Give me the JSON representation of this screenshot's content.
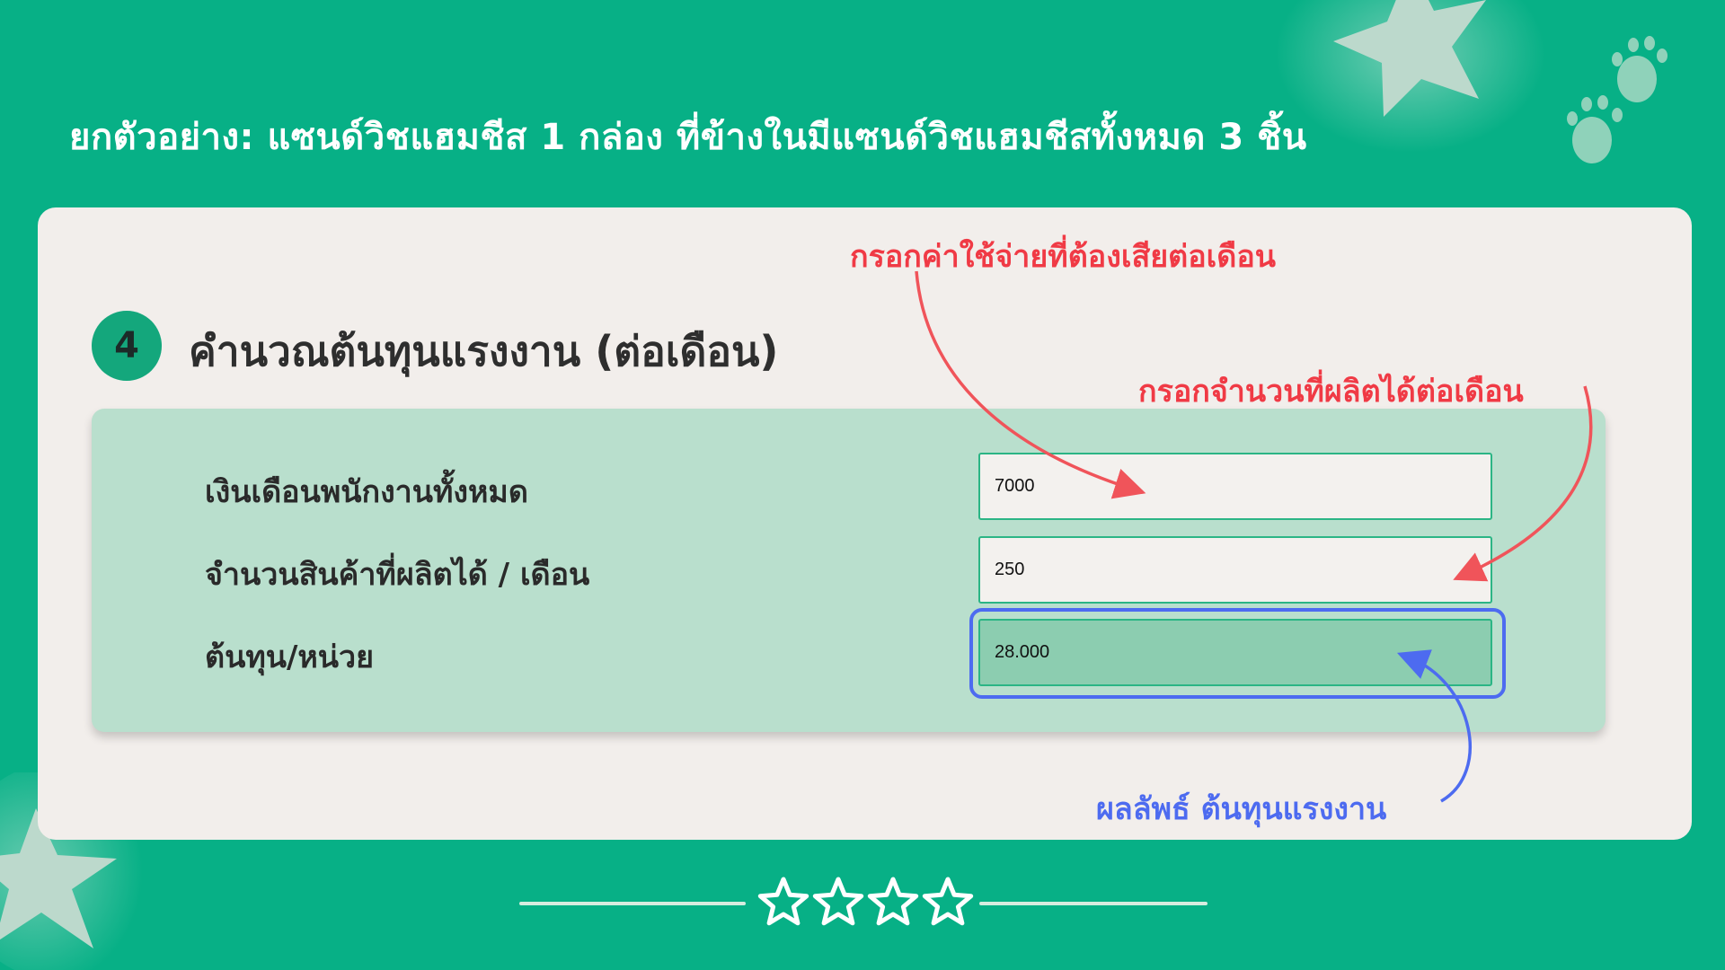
{
  "header": {
    "title": "ยกตัวอย่าง: แซนด์วิชแฮมชีส 1 กล่อง ที่ข้างในมีแซนด์วิชแฮมชีสทั้งหมด 3 ชิ้น"
  },
  "section": {
    "step_number": "4",
    "title": "คำนวณต้นทุนแรงงาน (ต่อเดือน)"
  },
  "form": {
    "fields": [
      {
        "label": "เงินเดือนพนักงานทั้งหมด",
        "value": "7000"
      },
      {
        "label": "จำนวนสินค้าที่ผลิตได้ / เดือน",
        "value": "250"
      },
      {
        "label": "ต้นทุน/หน่วย",
        "value": "28.000"
      }
    ]
  },
  "annotations": {
    "monthly_cost": "กรอกค่าใช้จ่ายที่ต้องเสียต่อเดือน",
    "monthly_output": "กรอกจำนวนที่ผลิตได้ต่อเดือน",
    "result": "ผลลัพธ์ ต้นทุนแรงงาน"
  },
  "colors": {
    "background": "#07b086",
    "card": "#f2eeeb",
    "panel": "#b9dfcd",
    "accent_green": "#14a77c",
    "annotation_red": "#f03a45",
    "annotation_blue": "#4d6bf0"
  },
  "icons": {
    "decor_top": "star-icon",
    "decor_paws": "paw-icon",
    "decor_bottom_left": "star-icon",
    "footer": "star-outline-icon"
  },
  "footer": {
    "star_count": 4
  }
}
